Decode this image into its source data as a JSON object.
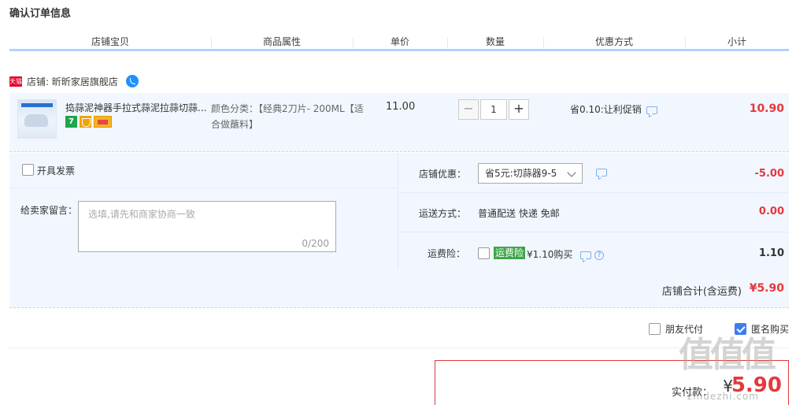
{
  "page_title": "确认订单信息",
  "columns": [
    "店铺宝贝",
    "商品属性",
    "单价",
    "数量",
    "优惠方式",
    "小计"
  ],
  "shop": {
    "badge": "天猫",
    "label": "店铺: 昕昕家居旗舰店"
  },
  "item": {
    "title": "捣蒜泥神器手拉式蒜泥拉蒜切蒜...",
    "badge_7": "7",
    "attr": "颜色分类：【经典2刀片- 200ML【适合做蘸料】",
    "price": "11.00",
    "qty": "1",
    "qty_minus": "−",
    "qty_plus": "+",
    "promo": "省0.10:让利促销",
    "subtotal": "10.90"
  },
  "invoice_label": "开具发票",
  "message": {
    "label": "给卖家留言：",
    "placeholder": "选填,请先和商家协商一致",
    "count": "0/200"
  },
  "shop_discount": {
    "label": "店铺优惠：",
    "selected": "省5元:切蒜器9-5",
    "value": "-5.00"
  },
  "shipping": {
    "label": "运送方式：",
    "value": "普通配送 快递 免邮",
    "fee": "0.00"
  },
  "insurance": {
    "label": "运费险：",
    "tag": "运费险",
    "price": "¥1.10购买",
    "value": "1.10"
  },
  "shop_total": {
    "label": "店铺合计(含运费)",
    "value": "¥5.90"
  },
  "friend_pay_label": "朋友代付",
  "anonymous_label": "匿名购买",
  "payment": {
    "label": "实付款：",
    "currency": "¥",
    "value": "5.90"
  },
  "watermark": "值值值",
  "watermark_sub": "zhidezhi.com",
  "colors": {
    "price_red": "#e4393c",
    "header_border": "#b2d1ff",
    "row_bg": "#f2f7ff",
    "checkbox_blue": "#3d7cf0",
    "insurance_green": "#3fa54a"
  }
}
